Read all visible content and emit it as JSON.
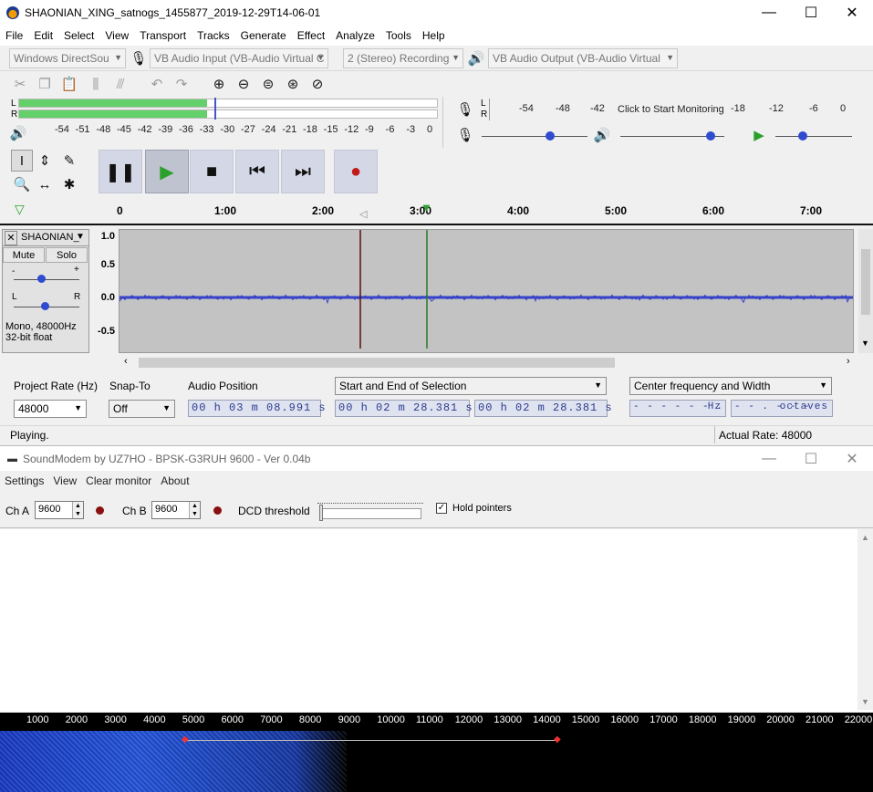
{
  "audacity": {
    "title": "SHAONIAN_XING_satnogs_1455877_2019-12-29T14-06-01",
    "menu": [
      "File",
      "Edit",
      "Select",
      "View",
      "Transport",
      "Tracks",
      "Generate",
      "Effect",
      "Analyze",
      "Tools",
      "Help"
    ],
    "device": {
      "host": "Windows DirectSou",
      "input": "VB Audio Input (VB-Audio Virtual C",
      "channels": "2 (Stereo) Recording",
      "output": "VB Audio Output (VB-Audio Virtual"
    },
    "playback_meter": {
      "l": "L",
      "r": "R",
      "scale": [
        "-54",
        "-51",
        "-48",
        "-45",
        "-42",
        "-39",
        "-36",
        "-33",
        "-30",
        "-27",
        "-24",
        "-21",
        "-18",
        "-15",
        "-12",
        "-9",
        "-6",
        "-3",
        "0"
      ],
      "level": 0.45
    },
    "record_meter": {
      "l": "L",
      "r": "R",
      "scale_left": [
        "-54",
        "-48",
        "-42"
      ],
      "monitor_text": "Click to Start Monitoring",
      "scale_right": [
        "-18",
        "-12",
        "-6",
        "0"
      ]
    },
    "timeline": [
      "0",
      "1:00",
      "2:00",
      "3:00",
      "4:00",
      "5:00",
      "6:00",
      "7:00"
    ],
    "track": {
      "name": "SHAONIAN_",
      "mute": "Mute",
      "solo": "Solo",
      "gain_minus": "-",
      "gain_plus": "+",
      "pan_l": "L",
      "pan_r": "R",
      "info1": "Mono, 48000Hz",
      "info2": "32-bit float",
      "yaxis": [
        "1.0",
        "0.5",
        "0.0",
        "-0.5"
      ]
    },
    "selection_toolbar": {
      "project_rate_label": "Project Rate (Hz)",
      "project_rate": "48000",
      "snap_to_label": "Snap-To",
      "snap_to": "Off",
      "audio_position_label": "Audio Position",
      "audio_position": "00 h 03 m 08.991 s",
      "selection_mode": "Start and End of Selection",
      "selection_start": "00 h 02 m 28.381 s",
      "selection_end": "00 h 02 m 28.381 s",
      "spectral_mode": "Center frequency and Width",
      "center_freq": "- - - - - - . - -",
      "center_unit": "Hz",
      "width": "- - . - - -",
      "width_unit": "octaves"
    },
    "status": {
      "left": "Playing.",
      "right": "Actual Rate: 48000"
    }
  },
  "soundmodem": {
    "title": "SoundModem by UZ7HO - BPSK-G3RUH 9600 - Ver 0.04b",
    "menu": [
      "Settings",
      "View",
      "Clear monitor",
      "About"
    ],
    "cha_label": "Ch A",
    "cha_value": "9600",
    "chb_label": "Ch B",
    "chb_value": "9600",
    "dcd_label": "DCD threshold",
    "hold_pointers": "Hold pointers",
    "waterfall_scale": [
      "1000",
      "2000",
      "3000",
      "4000",
      "5000",
      "6000",
      "7000",
      "8000",
      "9000",
      "10000",
      "11000",
      "12000",
      "13000",
      "14000",
      "15000",
      "16000",
      "17000",
      "18000",
      "19000",
      "20000",
      "21000",
      "22000"
    ]
  },
  "colors": {
    "meter_green": "#64d06a",
    "waveform": "#3743c8",
    "cursor_red": "#8b0000",
    "play_cursor": "#2a7a2a",
    "waterfall_blue": "#1a3cc8"
  }
}
